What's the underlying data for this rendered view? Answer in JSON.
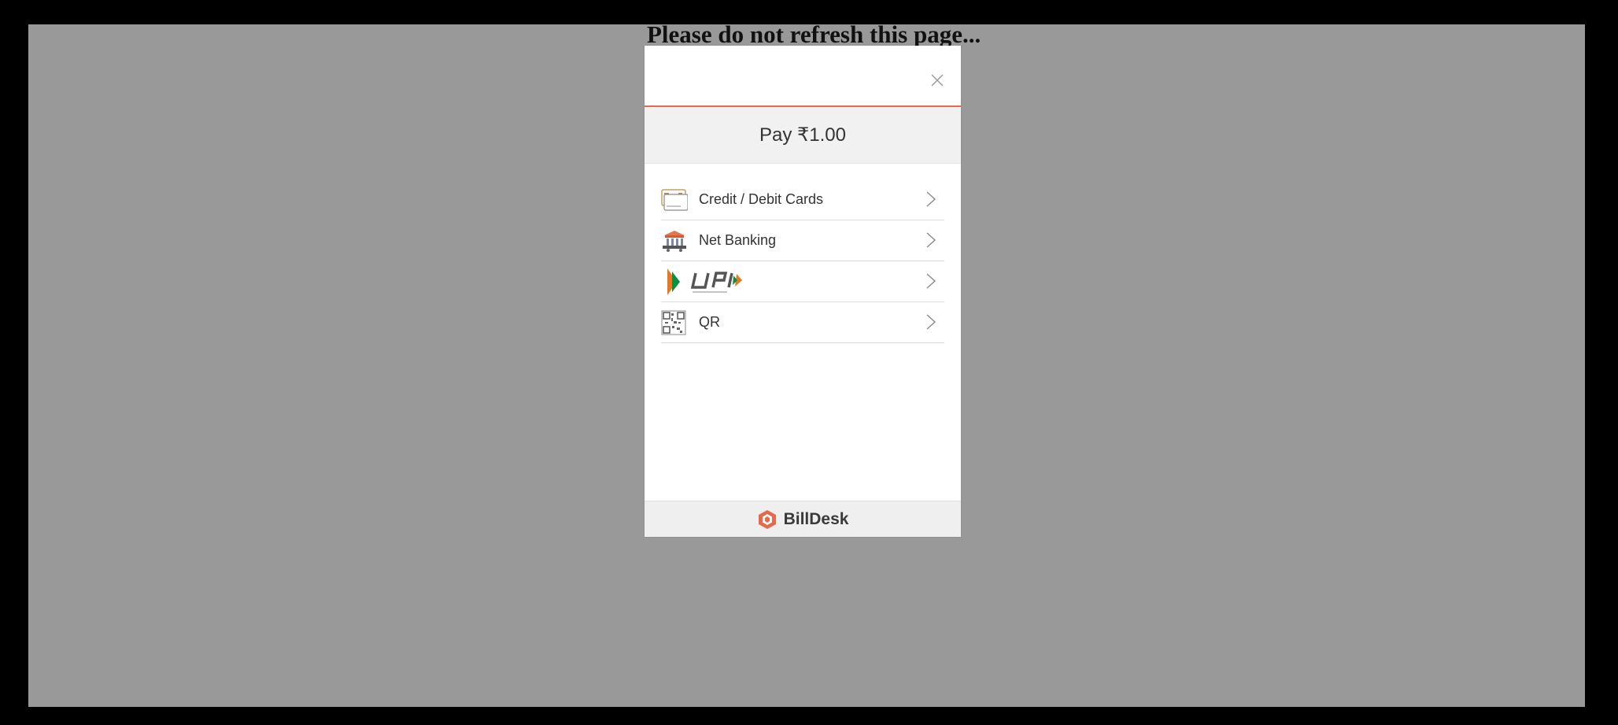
{
  "page": {
    "heading": "Please do not refresh this page..."
  },
  "modal": {
    "pay_label": "Pay ₹1.00",
    "accent_color": "#e8694a",
    "options": [
      {
        "label": "Credit / Debit Cards",
        "icon": "card-icon"
      },
      {
        "label": "Net Banking",
        "icon": "bank-icon"
      },
      {
        "label": "UPI",
        "icon": "upi-logo-icon"
      },
      {
        "label": "QR",
        "icon": "qr-code-icon"
      }
    ],
    "footer_brand": "BillDesk"
  }
}
